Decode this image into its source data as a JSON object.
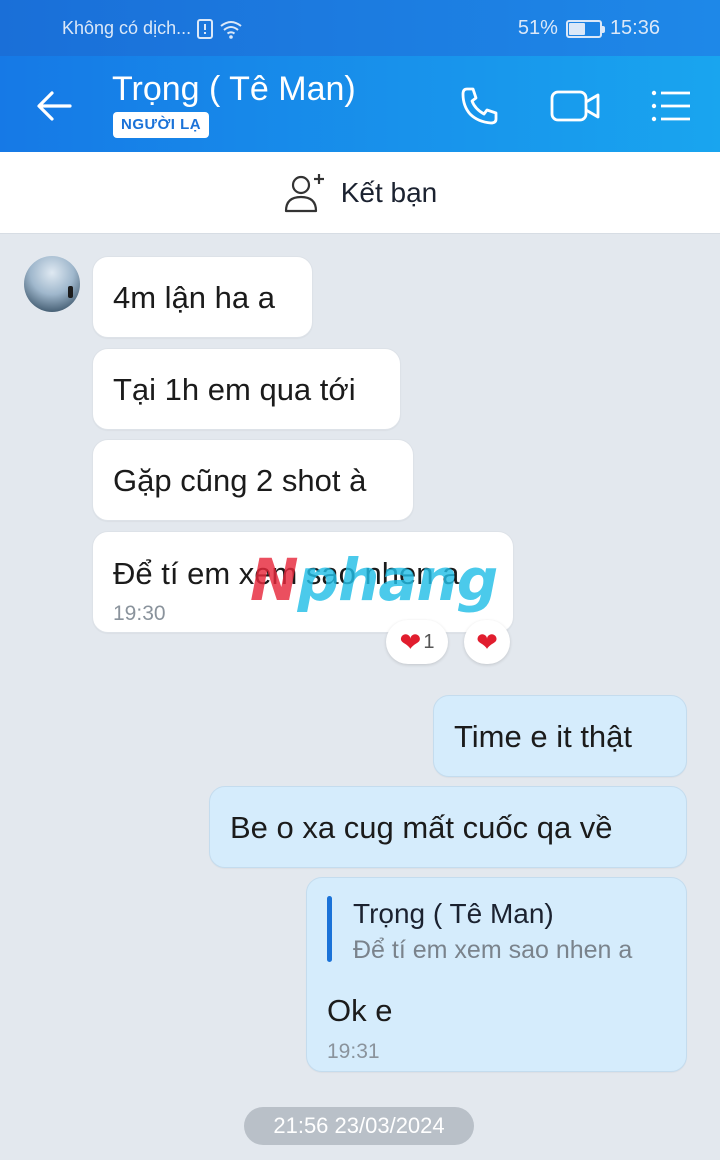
{
  "status_bar": {
    "carrier": "Không có dịch...",
    "battery": "51%",
    "battery_level": 0.51,
    "time": "15:36"
  },
  "header": {
    "contact_name": "Trọng ( Tê Man)",
    "badge": "NGƯỜI LẠ",
    "icons": [
      "back-arrow-icon",
      "phone-icon",
      "video-call-icon",
      "menu-list-icon"
    ]
  },
  "add_friend": {
    "label": "Kết bạn",
    "icon": "add-person-icon"
  },
  "messages": [
    {
      "direction": "in",
      "text": "4m lận ha a"
    },
    {
      "direction": "in",
      "text": "Tại 1h em qua tới"
    },
    {
      "direction": "in",
      "text": "Gặp cũng 2 shot à"
    },
    {
      "direction": "in",
      "text": "Để tí em xem sao nhen a",
      "time": "19:30",
      "reactions": {
        "count": "1",
        "icon": "heart-icon",
        "react_button_icon": "heart-icon"
      }
    },
    {
      "direction": "out",
      "text": "Time e it thật"
    },
    {
      "direction": "out",
      "text": "Be o xa cug mất cuốc qa về"
    },
    {
      "direction": "out",
      "text": "Ok e",
      "time": "19:31",
      "quote": {
        "name": "Trọng ( Tê Man)",
        "text": "Để tí em xem sao nhen a"
      }
    }
  ],
  "watermark": {
    "part1": "N",
    "part2": "phang"
  },
  "date_separator": "21:56 23/03/2024",
  "colors": {
    "header_gradient_start": "#1679e6",
    "header_gradient_end": "#19a5ef",
    "incoming_bubble": "#ffffff",
    "outgoing_bubble": "#d5ecfc",
    "chat_background": "#e3e8ee",
    "heart": "#e11d2e"
  }
}
